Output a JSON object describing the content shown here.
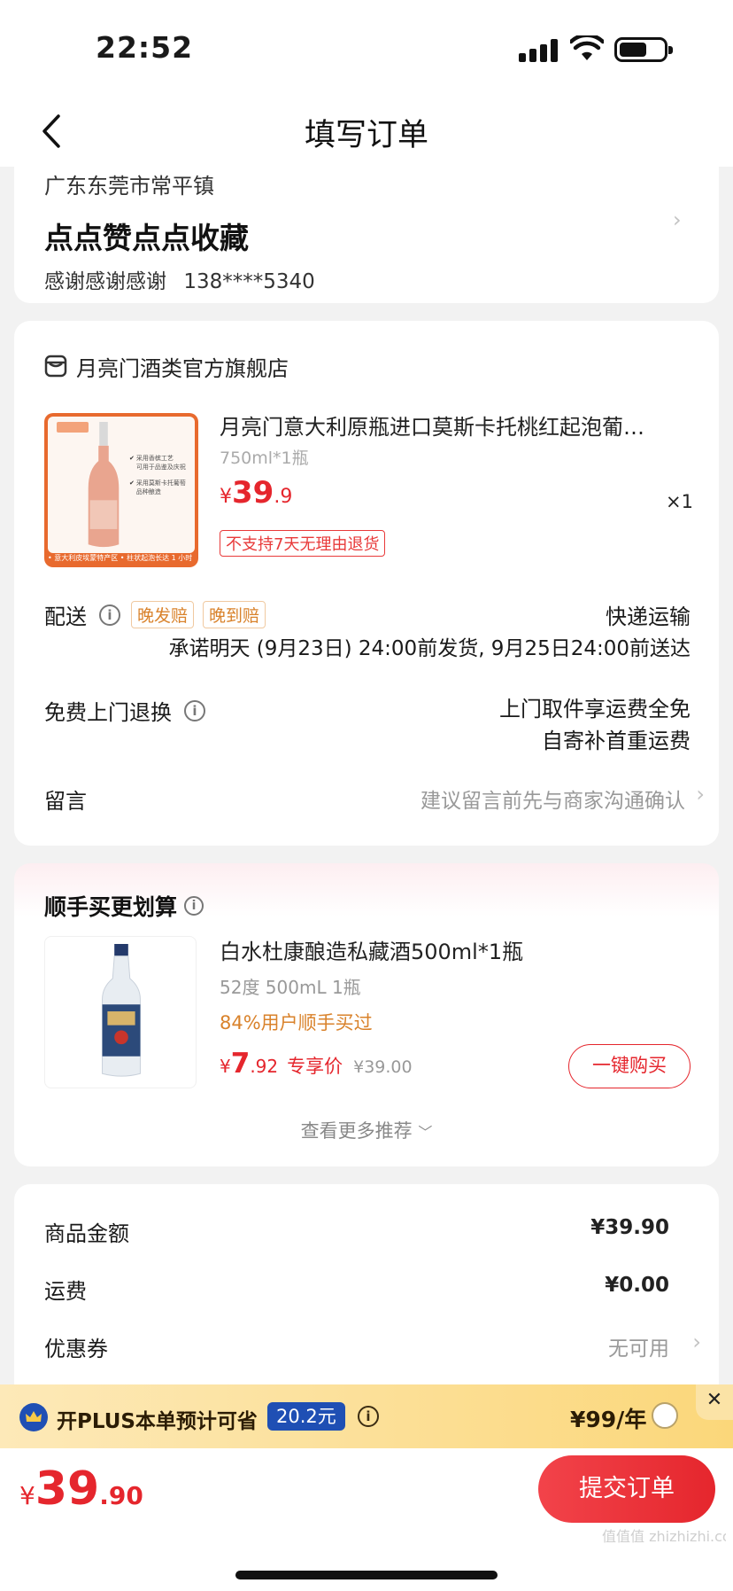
{
  "status": {
    "time": "22:52"
  },
  "nav": {
    "title": "填写订单"
  },
  "address": {
    "region": "广东东莞市常平镇",
    "detail": "点点赞点点收藏",
    "contact": "感谢感谢感谢",
    "phone": "138****5340"
  },
  "store": {
    "name": "月亮门酒类官方旗舰店",
    "product": {
      "title": "月亮门意大利原瓶进口莫斯卡托桃红起泡葡…",
      "spec": "750ml*1瓶",
      "currency": "¥",
      "price_int": "39",
      "price_dec": ".9",
      "qty": "×1",
      "return_tag": "不支持7天无理由退货",
      "image_badge": "• 意大利皮埃蒙特产区 • 柱状起泡长达 1 小时",
      "image_checks": [
        "采用香槟工艺\n可用于品鉴及庆祝",
        "采用莫斯卡托葡萄\n品种酿造"
      ]
    },
    "delivery": {
      "label": "配送",
      "tags": [
        "晚发赔",
        "晚到赔"
      ],
      "method": "快递运输",
      "promise": "承诺明天 (9月23日) 24:00前发货, 9月25日24:00前送达"
    },
    "returns": {
      "label": "免费上门退换",
      "line1": "上门取件享运费全免",
      "line2": "自寄补首重运费"
    },
    "message": {
      "label": "留言",
      "placeholder": "建议留言前先与商家沟通确认"
    }
  },
  "addon": {
    "title": "顺手买更划算",
    "product": {
      "title": "白水杜康酿造私藏酒500ml*1瓶",
      "spec": "52度 500mL 1瓶",
      "stat": "84%用户顺手买过",
      "currency": "¥",
      "price_int": "7",
      "price_dec": ".92",
      "price_tag": "专享价",
      "original": "¥39.00",
      "buy_button": "一键购买"
    },
    "more": "查看更多推荐"
  },
  "summary": {
    "rows": [
      {
        "label": "商品金额",
        "value": "¥39.90"
      },
      {
        "label": "运费",
        "value": "¥0.00"
      },
      {
        "label": "优惠券",
        "value": "无可用"
      }
    ]
  },
  "plus": {
    "text": "开PLUS本单预计可省",
    "saving": "20.2元",
    "price": "¥99/年"
  },
  "footer": {
    "currency": "¥",
    "total_int": "39",
    "total_dec": ".90",
    "submit": "提交订单"
  },
  "watermark": "值值值 zhizhizhi.com",
  "colors": {
    "accent": "#e5262d",
    "orange": "#d9822b",
    "plus_blue": "#1f4fb4"
  }
}
